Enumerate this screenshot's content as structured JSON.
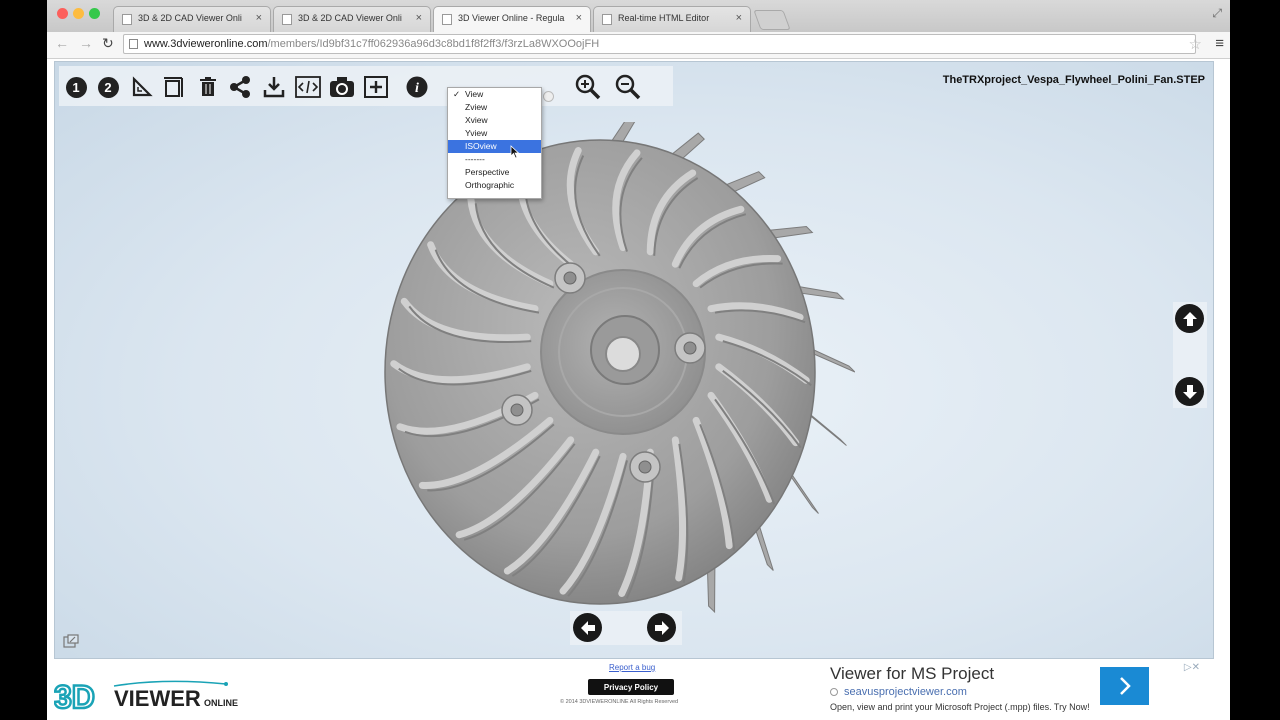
{
  "browser": {
    "tabs": [
      {
        "label": "3D & 2D CAD Viewer Onli",
        "active": false
      },
      {
        "label": "3D & 2D CAD Viewer Onli",
        "active": false
      },
      {
        "label": "3D Viewer Online - Regula",
        "active": true
      },
      {
        "label": "Real-time HTML Editor",
        "active": false
      }
    ],
    "url": {
      "host": "www.3dvieweronline.com",
      "path": "/members/Id9bf31c7ff062936a96d3c8bd1f8f2ff3/f3rzLa8WXOOojFH"
    },
    "colors": {
      "close": "#fc605c",
      "minimize": "#fdbc40",
      "maximize": "#34c84a"
    }
  },
  "toolbar": {
    "buttons": [
      {
        "name": "view-1-button",
        "glyph": "1"
      },
      {
        "name": "view-2-button",
        "glyph": "2"
      }
    ],
    "icons": [
      "measure-icon",
      "section-icon",
      "trash-icon",
      "share-icon",
      "download-icon",
      "embed-code-icon",
      "camera-icon",
      "fit-icon",
      "info-icon",
      "zoom-in-icon",
      "zoom-out-icon"
    ]
  },
  "model": {
    "filename": "TheTRXproject_Vespa_Flywheel_Polini_Fan.STEP"
  },
  "view_menu": {
    "items": [
      {
        "label": "View",
        "checked": true,
        "highlighted": false
      },
      {
        "label": "Zview",
        "checked": false,
        "highlighted": false
      },
      {
        "label": "Xview",
        "checked": false,
        "highlighted": false
      },
      {
        "label": "Yview",
        "checked": false,
        "highlighted": false
      },
      {
        "label": "ISOview",
        "checked": false,
        "highlighted": true
      },
      {
        "label": "-------",
        "checked": false,
        "highlighted": false
      },
      {
        "label": "Perspective",
        "checked": false,
        "highlighted": false
      },
      {
        "label": "Orthographic",
        "checked": false,
        "highlighted": false
      }
    ],
    "check_glyph": "✓"
  },
  "footer": {
    "logo_main": "3D",
    "logo_word": "VIEWER",
    "logo_small": "ONLINE",
    "report_bug": "Report a bug",
    "privacy_policy": "Privacy Policy",
    "copyright": "© 2014 3DVIEWERONLINE All Rights Reserved"
  },
  "ad": {
    "title": "Viewer for MS Project",
    "url": "seavusprojectviewer.com",
    "description": "Open, view and print your Microsoft Project (.mpp) files. Try Now!",
    "marks": "▷✕"
  }
}
